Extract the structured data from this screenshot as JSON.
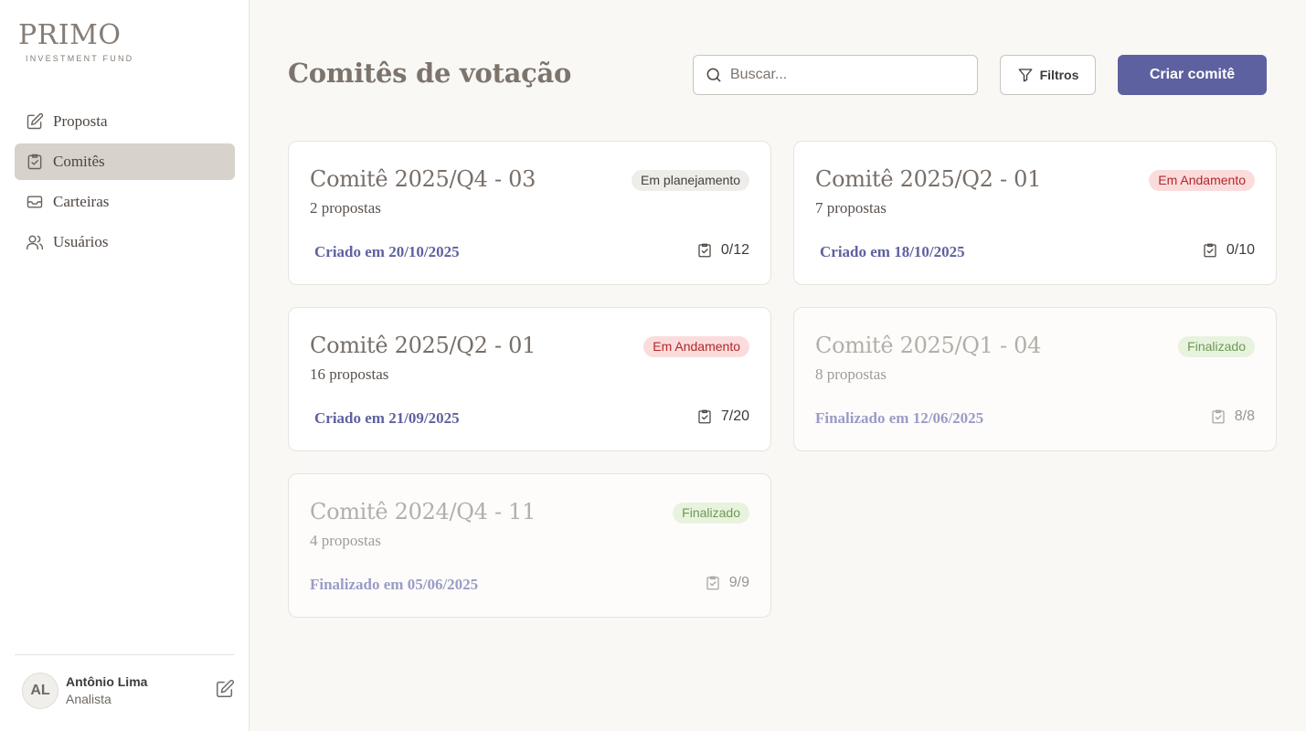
{
  "brand": {
    "name": "PRIMO",
    "tagline": "INVESTMENT FUND"
  },
  "nav": [
    {
      "label": "Proposta",
      "icon": "pencil-square-icon",
      "active": false
    },
    {
      "label": "Comitês",
      "icon": "clipboard-check-icon",
      "active": true
    },
    {
      "label": "Carteiras",
      "icon": "inbox-icon",
      "active": false
    },
    {
      "label": "Usuários",
      "icon": "users-icon",
      "active": false
    }
  ],
  "user": {
    "initials": "AL",
    "name": "Antônio Lima",
    "role": "Analista"
  },
  "header": {
    "title": "Comitês de votação",
    "search_placeholder": "Buscar...",
    "filter_label": "Filtros",
    "create_label": "Criar comitê"
  },
  "committees": [
    {
      "title": "Comitê 2025/Q4 - 03",
      "count": "2 propostas",
      "status": "Em planejamento",
      "date": "Criado em 20/10/2025",
      "progress": "0/12"
    },
    {
      "title": "Comitê 2025/Q2 - 01",
      "count": "7 propostas",
      "status": "Em Andamento",
      "date": "Criado em 18/10/2025",
      "progress": "0/10"
    },
    {
      "title": "Comitê 2025/Q2 - 01",
      "count": "16 propostas",
      "status": "Em Andamento",
      "date": "Criado em 21/09/2025",
      "progress": "7/20"
    },
    {
      "title": "Comitê 2025/Q1 - 04",
      "count": "8 propostas",
      "status": "Finalizado",
      "date": "Finalizado em 12/06/2025",
      "progress": "8/8"
    },
    {
      "title": "Comitê 2024/Q4 - 11",
      "count": "4 propostas",
      "status": "Finalizado",
      "date": "Finalizado em 05/06/2025",
      "progress": "9/9"
    }
  ],
  "colors": {
    "accent": "#5e619f",
    "progress_badge": "#b3262a",
    "final_badge": "#6c9a55"
  }
}
